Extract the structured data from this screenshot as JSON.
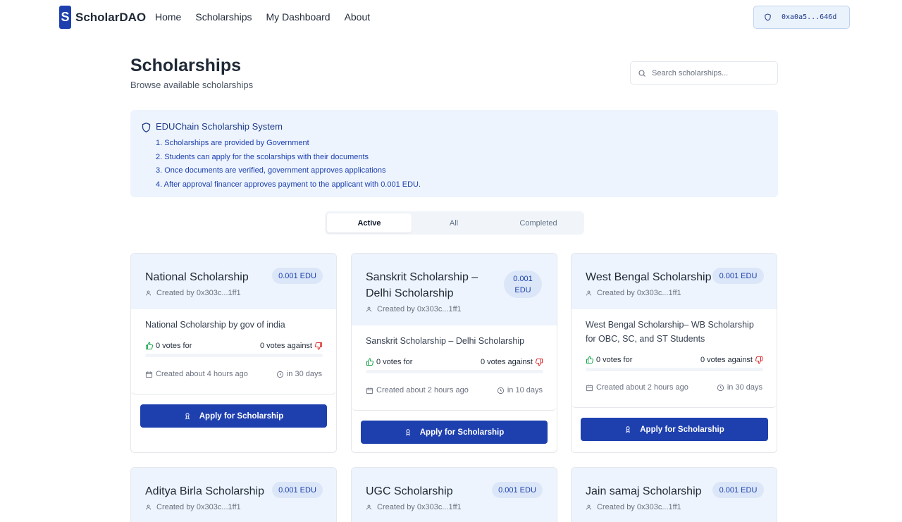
{
  "nav": {
    "logo_letter": "S",
    "brand": "ScholarDAO",
    "links": [
      "Home",
      "Scholarships",
      "My Dashboard",
      "About"
    ],
    "wallet": "0xa0a5...646d"
  },
  "header": {
    "title": "Scholarships",
    "subtitle": "Browse available scholarships",
    "search_placeholder": "Search scholarships..."
  },
  "info": {
    "title": "EDUChain Scholarship System",
    "items": [
      "1. Scholarships are provided by Government",
      "2. Students can apply for the scolarships with their documents",
      "3. Once documents are verified, government approves applications",
      "4. After approval financer approves payment to the applicant with 0.001 EDU."
    ]
  },
  "tabs": [
    "Active",
    "All",
    "Completed"
  ],
  "active_tab": "Active",
  "cards": [
    {
      "title": "National Scholarship",
      "amount": "0.001 EDU",
      "creator": "Created by 0x303c...1ff1",
      "description": "National Scholarship by gov of india",
      "votes_for": "0 votes for",
      "votes_against": "0 votes against",
      "created": "Created about 4 hours ago",
      "deadline": "in 30 days",
      "apply": "Apply for Scholarship"
    },
    {
      "title": "Sanskrit Scholarship – Delhi Scholarship",
      "amount": "0.001 EDU",
      "creator": "Created by 0x303c...1ff1",
      "description": "Sanskrit Scholarship – Delhi Scholarship",
      "votes_for": "0 votes for",
      "votes_against": "0 votes against",
      "created": "Created about 2 hours ago",
      "deadline": "in 10 days",
      "apply": "Apply for Scholarship"
    },
    {
      "title": "West Bengal Scholarship",
      "amount": "0.001 EDU",
      "creator": "Created by 0x303c...1ff1",
      "description": "West Bengal Scholarship– WB Scholarship for OBC, SC, and ST Students",
      "votes_for": "0 votes for",
      "votes_against": "0 votes against",
      "created": "Created about 2 hours ago",
      "deadline": "in 30 days",
      "apply": "Apply for Scholarship"
    },
    {
      "title": "Aditya Birla Scholarship",
      "amount": "0.001 EDU",
      "creator": "Created by 0x303c...1ff1"
    },
    {
      "title": "UGC Scholarship",
      "amount": "0.001 EDU",
      "creator": "Created by 0x303c...1ff1"
    },
    {
      "title": "Jain samaj Scholarship",
      "amount": "0.001 EDU",
      "creator": "Created by 0x303c...1ff1"
    }
  ],
  "colors": {
    "primary": "#1e40af",
    "info_bg": "#edf4fd",
    "vote_for": "#16a34a",
    "vote_against": "#dc2626"
  }
}
